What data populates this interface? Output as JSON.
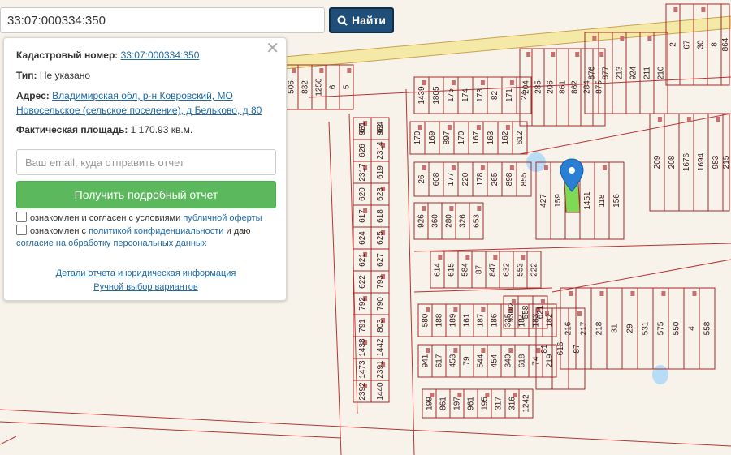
{
  "search": {
    "value": "33:07:000334:350",
    "button_label": "Найти"
  },
  "info": {
    "cadastral_label": "Кадастровый номер:",
    "cadastral_value": "33:07:000334:350",
    "type_label": "Тип:",
    "type_value": "Не указано",
    "address_label": "Адрес:",
    "address_line1": "Владимирская обл, р-н Ковровский, МО",
    "address_line2": "Новосельское (сельское поселение), д Бельково, д 80",
    "area_label": "Фактическая площадь:",
    "area_value": "1 170.93 кв.м."
  },
  "form": {
    "email_placeholder": "Ваш email, куда отправить отчет",
    "report_button": "Получить подробный отчет",
    "check1_text": "ознакомлен и согласен с условиями",
    "check1_link": "публичной оферты",
    "check2_text": "ознакомлен с",
    "check2_link1": "политикой конфиденциальности",
    "check2_mid": "и даю",
    "check2_link2": "согласие на обработку персональных данных"
  },
  "links": {
    "details": "Детали отчета и юридическая информация",
    "manual": "Ручной выбор вариантов"
  },
  "colors": {
    "parcel_line": "#a52a2a",
    "road_fill": "#f5e9a8",
    "selected_parcel": "#7ed957",
    "marker": "#2a7fd4",
    "search_button": "#1f4e79",
    "report_button": "#5cb85c"
  },
  "map_labels": [
    "931",
    "984",
    "626",
    "2314",
    "2317",
    "619",
    "620",
    "623",
    "617",
    "618",
    "624",
    "625",
    "621",
    "627",
    "622",
    "793",
    "792",
    "790",
    "791",
    "803",
    "1438",
    "1442",
    "1473",
    "2391",
    "2392",
    "1440",
    "1439",
    "1805",
    "175",
    "174",
    "173",
    "82",
    "171",
    "24",
    "170",
    "169",
    "897",
    "170",
    "167",
    "163",
    "162",
    "612",
    "26",
    "608",
    "177",
    "220",
    "178",
    "265",
    "898",
    "855",
    "926",
    "360",
    "280",
    "326",
    "653",
    "614",
    "615",
    "584",
    "87",
    "847",
    "632",
    "553",
    "222",
    "580",
    "188",
    "189",
    "161",
    "187",
    "186",
    "335",
    "184",
    "183",
    "182",
    "941",
    "617",
    "453",
    "79",
    "544",
    "454",
    "349",
    "618",
    "74",
    "219",
    "199",
    "861",
    "197",
    "961",
    "195",
    "317",
    "316",
    "1242",
    "204",
    "285",
    "206",
    "861",
    "862",
    "284",
    "875",
    "876",
    "877",
    "213",
    "924",
    "211",
    "210",
    "209",
    "208",
    "1676",
    "1694",
    "983",
    "215",
    "216",
    "217",
    "218",
    "31",
    "29",
    "531",
    "575",
    "550",
    "4",
    "558",
    "930/2",
    "558",
    "621",
    "427",
    "159",
    "291",
    "1451",
    "118",
    "156",
    "506",
    "832",
    "1250",
    "6",
    "5",
    "2",
    "67",
    "30",
    "8",
    "864",
    "81",
    "616",
    "87",
    "67",
    "62"
  ]
}
